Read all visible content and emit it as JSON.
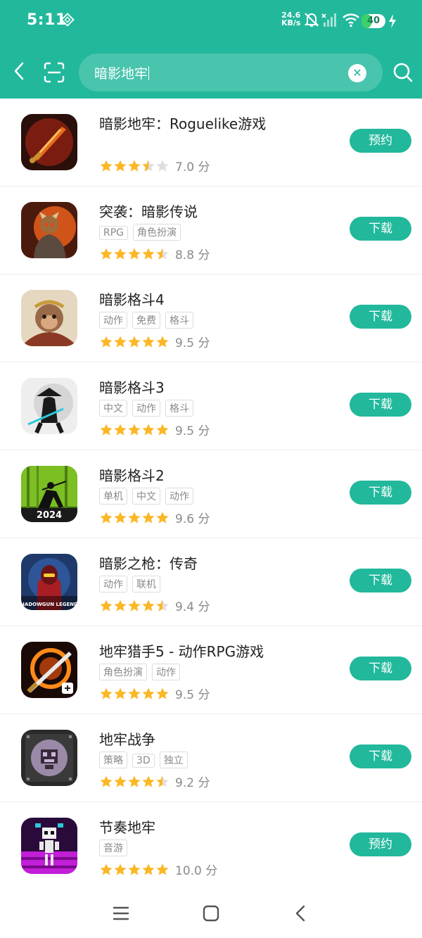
{
  "status_bar": {
    "time": "5:11",
    "net_speed_value": "24.6",
    "net_speed_unit": "KB/s",
    "battery": "40",
    "battery_level": 0.4
  },
  "search": {
    "query": "暗影地牢"
  },
  "apps": [
    {
      "name": "暗影地牢：Roguelike游戏",
      "tags": [],
      "rating": 3.5,
      "score": "7.0 分",
      "action": "预约",
      "icon": "flaming-sword-icon"
    },
    {
      "name": "突袭：暗影传说",
      "tags": [
        "RPG",
        "角色扮演"
      ],
      "rating": 4.5,
      "score": "8.8 分",
      "action": "下载",
      "icon": "warrior-icon"
    },
    {
      "name": "暗影格斗4",
      "tags": [
        "动作",
        "免费",
        "格斗"
      ],
      "rating": 5,
      "score": "9.5 分",
      "action": "下载",
      "icon": "monkey-king-icon"
    },
    {
      "name": "暗影格斗3",
      "tags": [
        "中文",
        "动作",
        "格斗"
      ],
      "rating": 5,
      "score": "9.5 分",
      "action": "下载",
      "icon": "ninja-icon"
    },
    {
      "name": "暗影格斗2",
      "tags": [
        "单机",
        "中文",
        "动作"
      ],
      "rating": 5,
      "score": "9.6 分",
      "action": "下载",
      "icon": "shadow-fighter-icon",
      "icon_text": "2024"
    },
    {
      "name": "暗影之枪：传奇",
      "tags": [
        "动作",
        "联机"
      ],
      "rating": 4.5,
      "score": "9.4 分",
      "action": "下载",
      "icon": "armored-soldier-icon",
      "icon_text": "SHADOWGUN LEGENDS"
    },
    {
      "name": "地牢猎手5 - 动作RPG游戏",
      "tags": [
        "角色扮演",
        "动作"
      ],
      "rating": 5,
      "score": "9.5 分",
      "action": "下载",
      "icon": "fire-sword-icon"
    },
    {
      "name": "地牢战争",
      "tags": [
        "策略",
        "3D",
        "独立"
      ],
      "rating": 4.5,
      "score": "9.2 分",
      "action": "下载",
      "icon": "pixel-skull-icon"
    },
    {
      "name": "节奏地牢",
      "tags": [
        "音游"
      ],
      "rating": 5,
      "score": "10.0 分",
      "action": "预约",
      "icon": "pixel-skeleton-icon"
    }
  ],
  "colors": {
    "accent": "#22b89c",
    "star": "#fbb724",
    "star_empty": "#dedede"
  }
}
